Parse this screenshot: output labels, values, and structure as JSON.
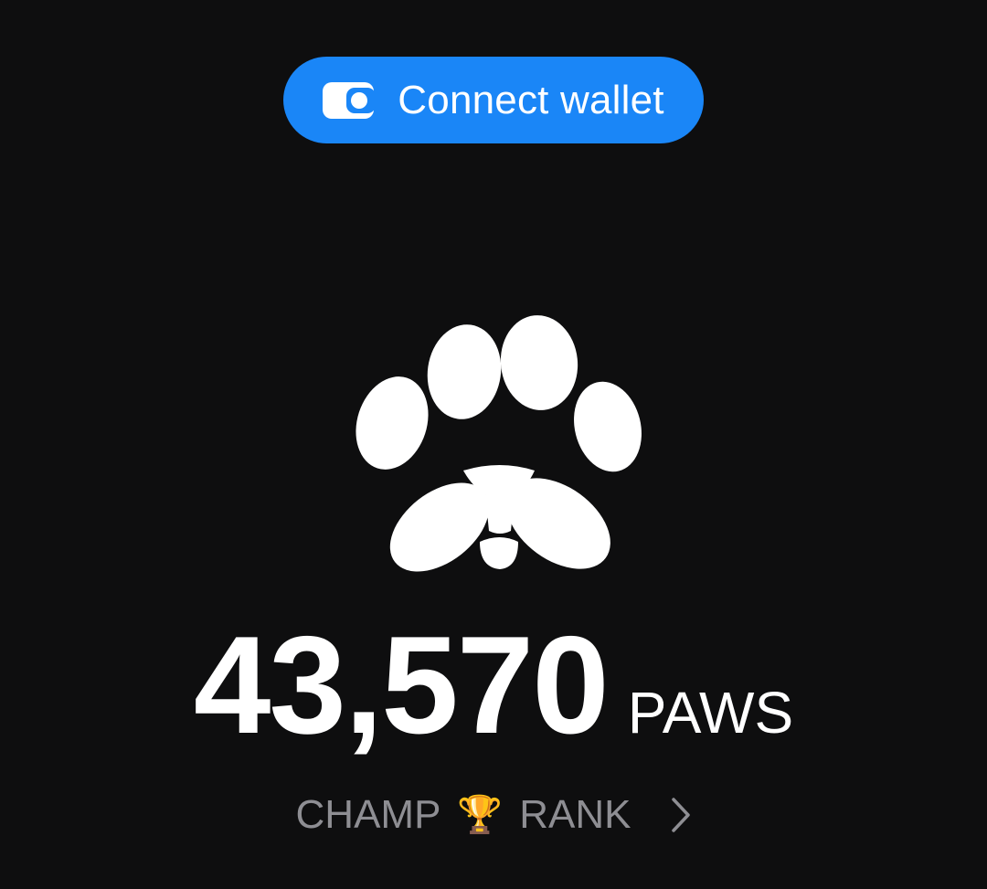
{
  "wallet_button": {
    "label": "Connect wallet",
    "icon": "wallet-icon",
    "color": "#1a86f7"
  },
  "logo": {
    "icon": "paw-icon"
  },
  "balance": {
    "value": "43,570",
    "unit": "PAWS"
  },
  "rank": {
    "tier": "CHAMP",
    "emoji": "🏆",
    "label": "RANK",
    "icon": "chevron-right-icon"
  }
}
